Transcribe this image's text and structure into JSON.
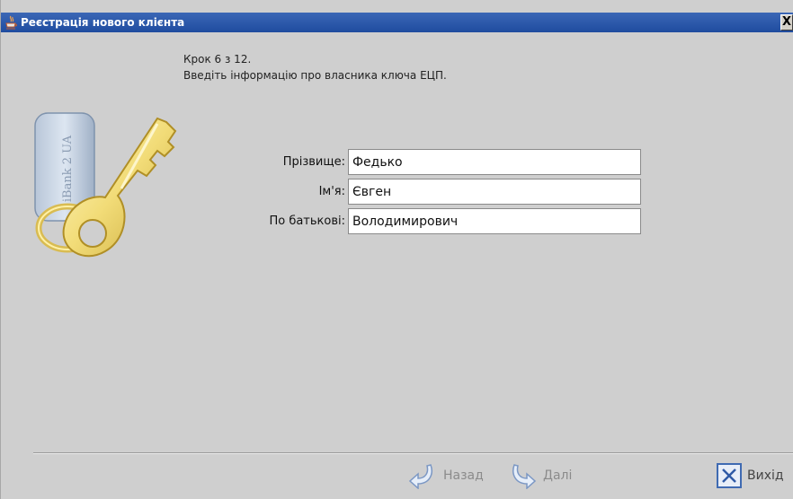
{
  "window": {
    "title": "Реєстрація нового клієнта",
    "close_label": "X"
  },
  "step": {
    "counter": "Крок 6 з 12.",
    "instruction": "Введіть інформацію про власника ключа ЕЦП."
  },
  "illustration": {
    "token_text": "iBank 2 UA",
    "icon": "usb-key-icon"
  },
  "form": {
    "fields": [
      {
        "label": "Прізвище:",
        "value": "Федько"
      },
      {
        "label": "Ім'я:",
        "value": "Євген"
      },
      {
        "label": "По батькові:",
        "value": "Володимирович"
      }
    ]
  },
  "footer": {
    "back_label": "Назад",
    "next_label": "Далі",
    "exit_label": "Вихід"
  },
  "colors": {
    "titlebar": "#2a56a8",
    "background": "#cfcfcf",
    "disabled_text": "#8b8b8b",
    "accent": "#3f6ab2"
  }
}
